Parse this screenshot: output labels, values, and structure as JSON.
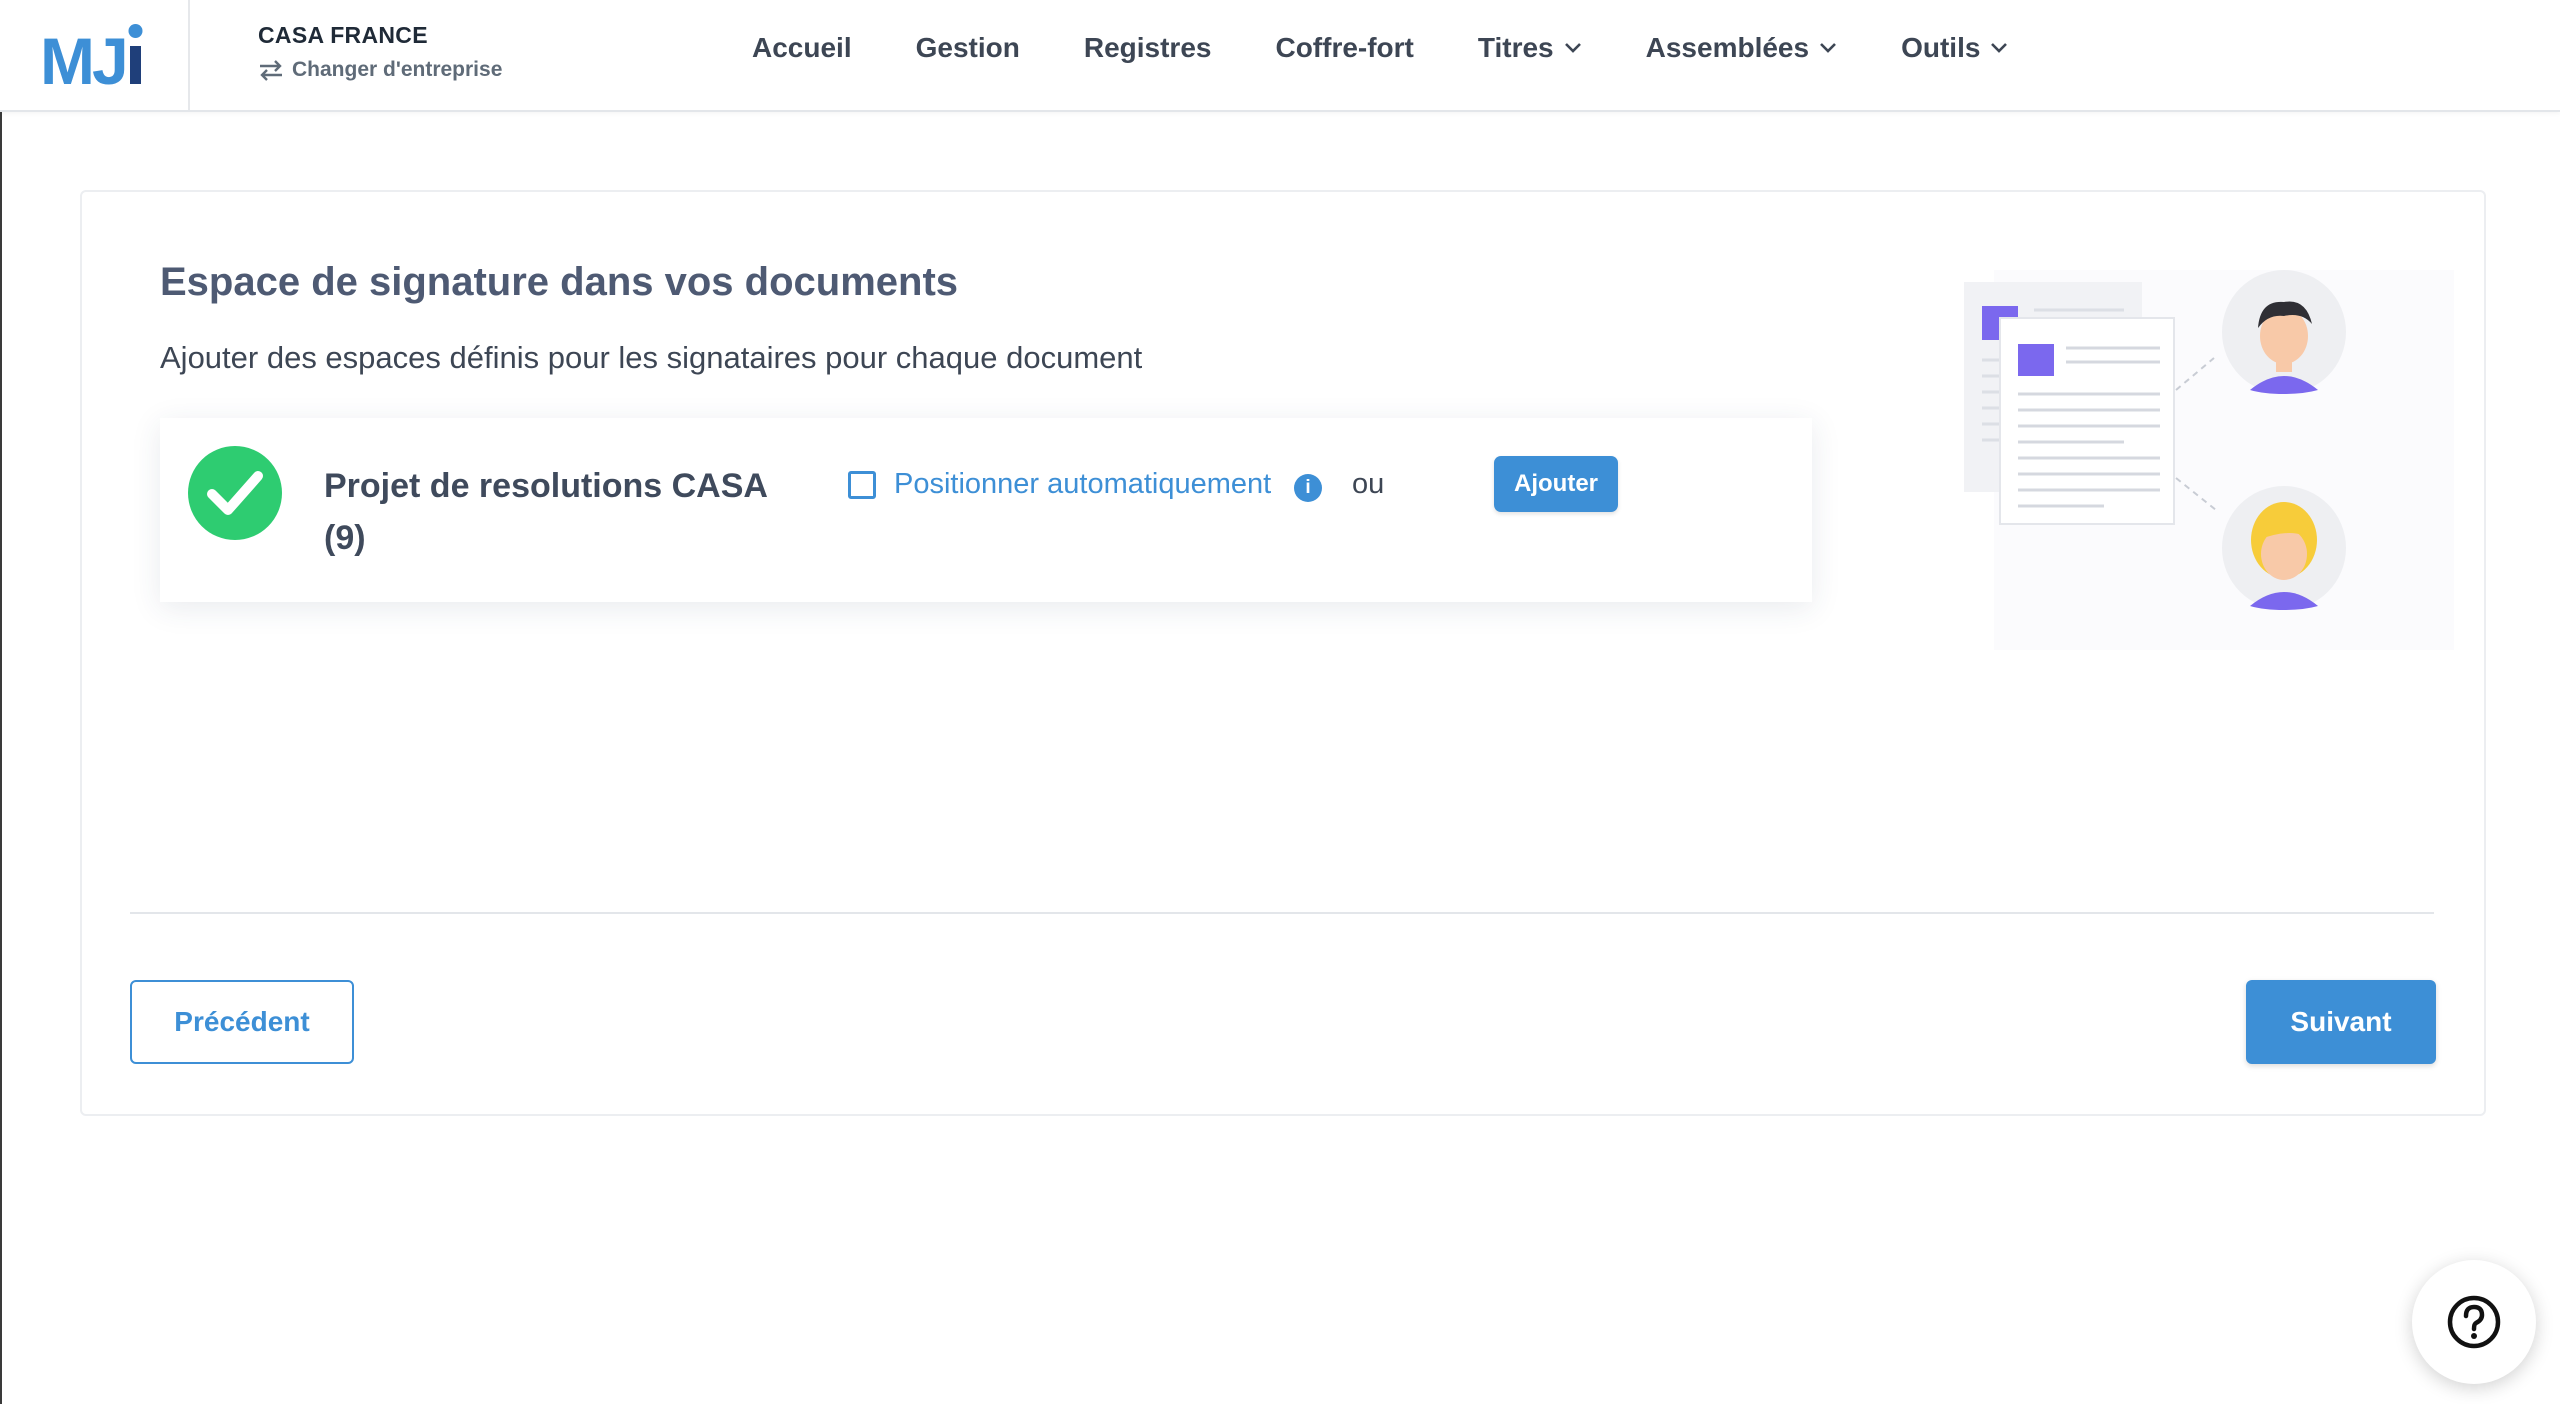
{
  "header": {
    "logo_text": "MJi",
    "company_name": "CASA FRANCE",
    "switch_label": "Changer d'entreprise",
    "nav": [
      {
        "label": "Accueil",
        "dropdown": false
      },
      {
        "label": "Gestion",
        "dropdown": false
      },
      {
        "label": "Registres",
        "dropdown": false
      },
      {
        "label": "Coffre-fort",
        "dropdown": false
      },
      {
        "label": "Titres",
        "dropdown": true
      },
      {
        "label": "Assemblées",
        "dropdown": true
      },
      {
        "label": "Outils",
        "dropdown": true
      }
    ]
  },
  "main": {
    "title": "Espace de signature dans vos documents",
    "subtitle": "Ajouter des espaces définis pour les signataires pour chaque document",
    "document": {
      "name": "Projet de resolutions CASA (9)",
      "status": "complete",
      "auto_position_label": "Positionner automatiquement",
      "auto_position_checked": false,
      "or_label": "ou",
      "add_label": "Ajouter"
    },
    "prev_label": "Précédent",
    "next_label": "Suivant"
  },
  "colors": {
    "accent": "#3d8fd6",
    "success": "#2ecc71",
    "title": "#4e5a73",
    "illustration_purple": "#7b68ee",
    "logo_blue": "#3d8fd6",
    "logo_dark": "#1f3f7a"
  },
  "icons": [
    "swap-arrows-icon",
    "chevron-down-icon",
    "check-circle-icon",
    "info-icon",
    "help-question-icon"
  ]
}
